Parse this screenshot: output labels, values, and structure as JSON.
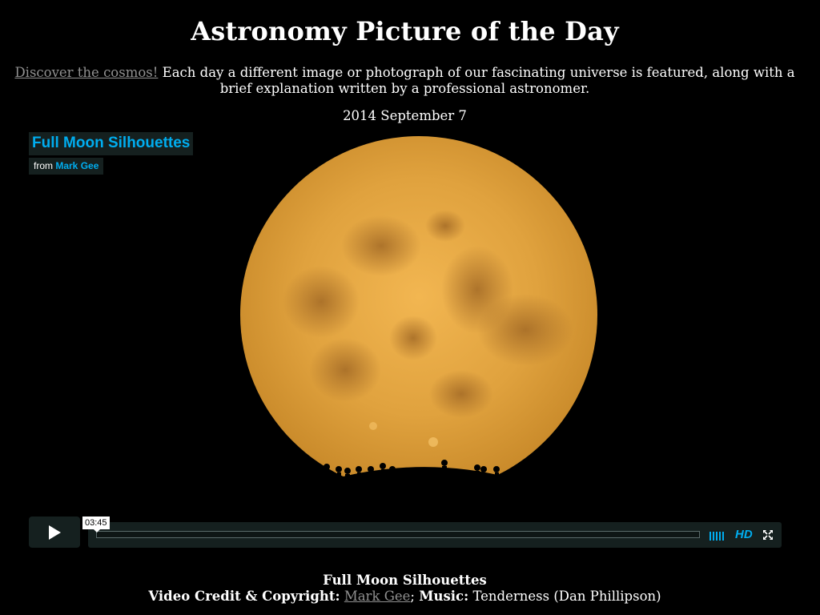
{
  "header": {
    "title": "Astronomy Picture of the Day"
  },
  "intro": {
    "link_text": "Discover the cosmos!",
    "text": " Each day a different image or photograph of our fascinating universe is featured, along with a brief explanation written by a professional astronomer."
  },
  "date": "2014 September 7",
  "video": {
    "title": "Full Moon Silhouettes",
    "byline_prefix": "from ",
    "byline_author": "Mark Gee",
    "duration": "03:45",
    "progress": 0,
    "hd_label": "HD",
    "icons": {
      "play": "play-icon",
      "volume": "volume-bars-icon",
      "fullscreen": "fullscreen-icon"
    },
    "colors": {
      "accent": "#00adef",
      "moon": "#e0a23e",
      "background": "#000000"
    }
  },
  "caption": {
    "title": "Full Moon Silhouettes",
    "credit_label": "Video Credit & Copyright:",
    "credit_author": "Mark Gee",
    "separator": ";",
    "music_label": "Music:",
    "music_value": "Tenderness (Dan Phillipson)"
  }
}
